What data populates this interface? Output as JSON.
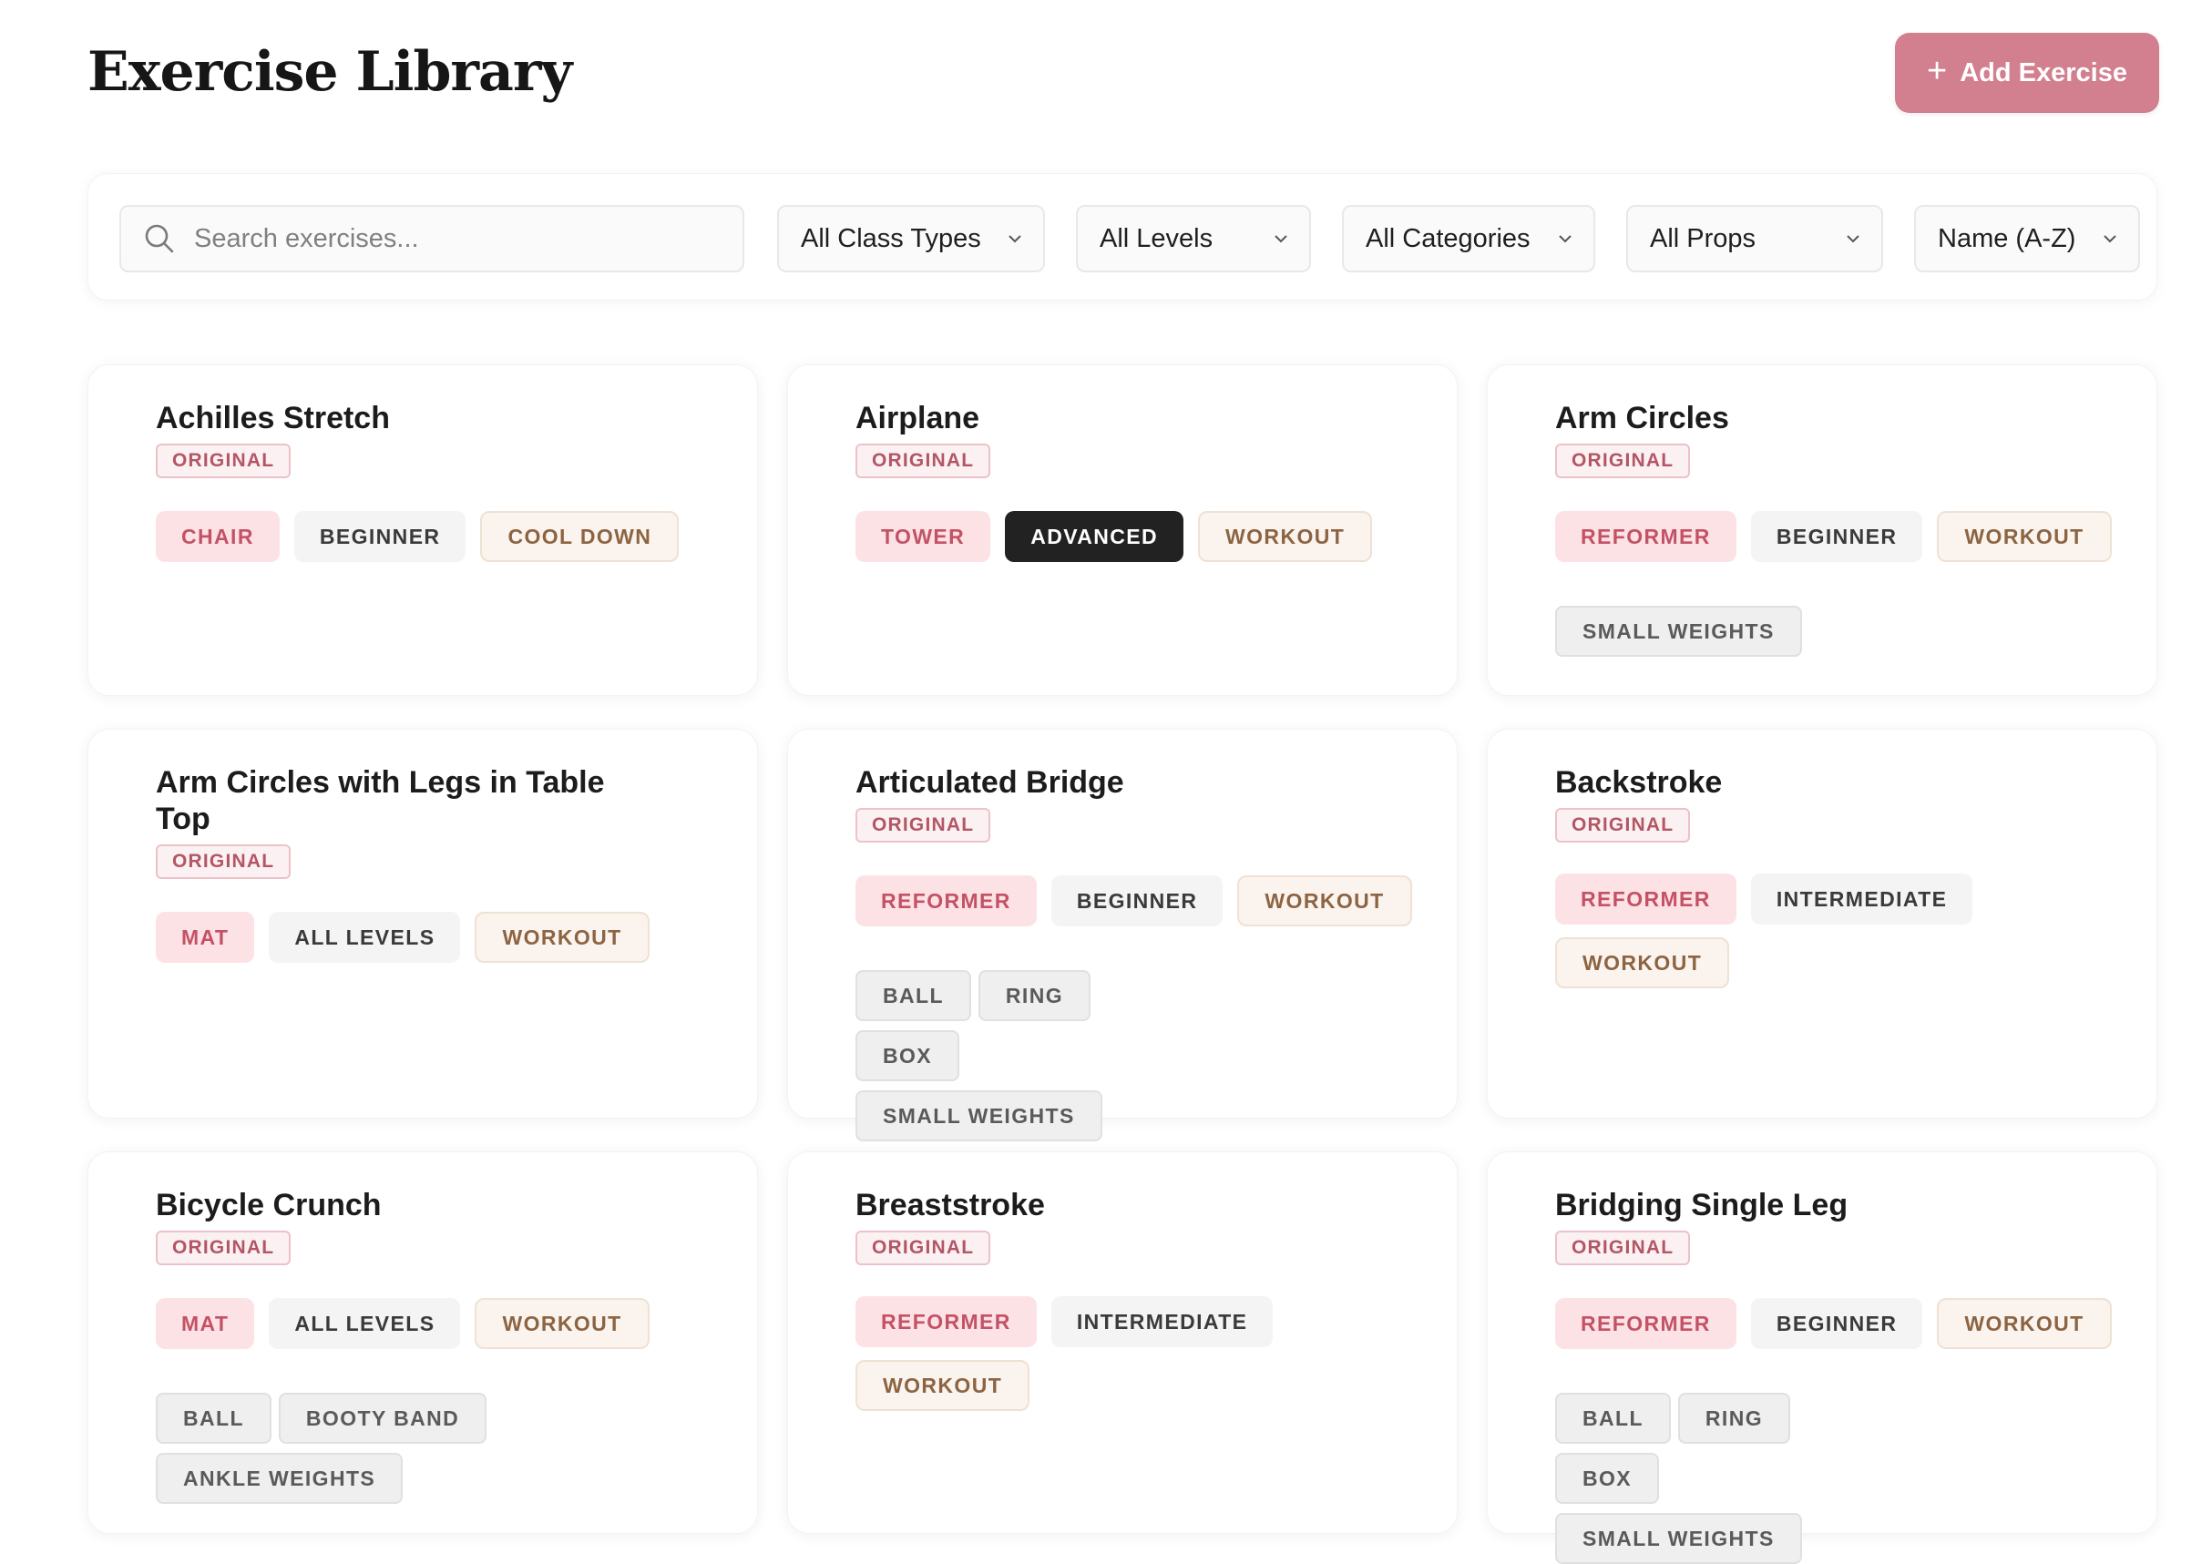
{
  "header": {
    "title": "Exercise Library",
    "add_button": {
      "icon": "plus-icon",
      "label": "Add Exercise"
    }
  },
  "filters": {
    "search_placeholder": "Search exercises...",
    "search_value": "",
    "class_type": "All Class Types",
    "level": "All Levels",
    "category": "All Categories",
    "props": "All Props",
    "sort": "Name (A-Z)"
  },
  "colors": {
    "accent": "#d27f8f",
    "equipment_tag_bg": "#fde2e5",
    "level_tag_bg": "#f4f4f4",
    "advanced_tag_bg": "#222222",
    "category_tag_bg": "#fbf4ee",
    "prop_tag_bg": "#efefef"
  },
  "exercises": [
    {
      "name": "Achilles Stretch",
      "badge": "ORIGINAL",
      "equipment": "CHAIR",
      "level": "BEGINNER",
      "category": "COOL DOWN",
      "props": []
    },
    {
      "name": "Airplane",
      "badge": "ORIGINAL",
      "equipment": "TOWER",
      "level": "ADVANCED",
      "category": "WORKOUT",
      "props": []
    },
    {
      "name": "Arm Circles",
      "badge": "ORIGINAL",
      "equipment": "REFORMER",
      "level": "BEGINNER",
      "category": "WORKOUT",
      "props": [
        "SMALL WEIGHTS"
      ]
    },
    {
      "name": "Arm Circles with Legs in Table Top",
      "badge": "ORIGINAL",
      "equipment": "MAT",
      "level": "ALL LEVELS",
      "category": "WORKOUT",
      "props": []
    },
    {
      "name": "Articulated Bridge",
      "badge": "ORIGINAL",
      "equipment": "REFORMER",
      "level": "BEGINNER",
      "category": "WORKOUT",
      "props": [
        "BALL",
        "RING",
        "BOX",
        "SMALL WEIGHTS"
      ]
    },
    {
      "name": "Backstroke",
      "badge": "ORIGINAL",
      "equipment": "REFORMER",
      "level": "INTERMEDIATE",
      "category": "WORKOUT",
      "props": []
    },
    {
      "name": "Bicycle Crunch",
      "badge": "ORIGINAL",
      "equipment": "MAT",
      "level": "ALL LEVELS",
      "category": "WORKOUT",
      "props": [
        "BALL",
        "BOOTY BAND",
        "ANKLE WEIGHTS"
      ]
    },
    {
      "name": "Breaststroke",
      "badge": "ORIGINAL",
      "equipment": "REFORMER",
      "level": "INTERMEDIATE",
      "category": "WORKOUT",
      "props": []
    },
    {
      "name": "Bridging Single Leg",
      "badge": "ORIGINAL",
      "equipment": "REFORMER",
      "level": "BEGINNER",
      "category": "WORKOUT",
      "props": [
        "BALL",
        "RING",
        "BOX",
        "SMALL WEIGHTS"
      ]
    }
  ]
}
